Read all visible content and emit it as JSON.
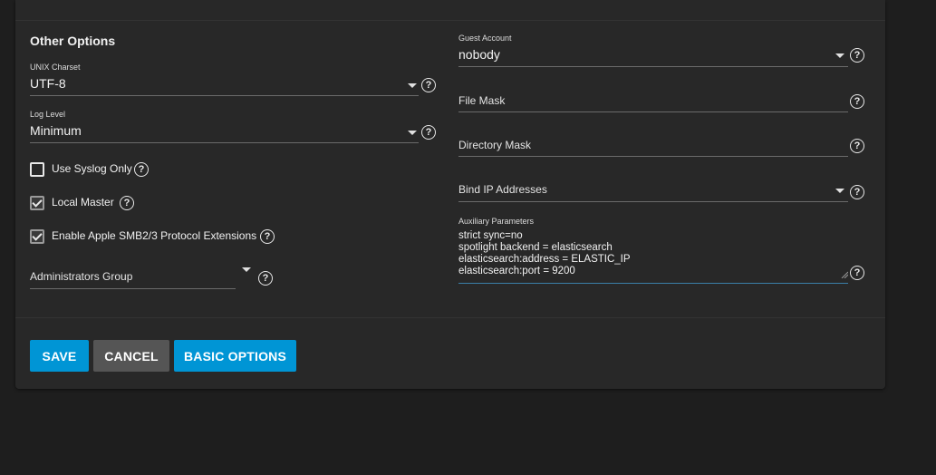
{
  "section": {
    "title": "Other Options"
  },
  "left": {
    "unix_charset": {
      "label": "UNIX Charset",
      "value": "UTF-8"
    },
    "log_level": {
      "label": "Log Level",
      "value": "Minimum"
    },
    "use_syslog": {
      "label": "Use Syslog Only",
      "checked": false
    },
    "local_master": {
      "label": "Local Master",
      "checked": true
    },
    "apple_ext": {
      "label": "Enable Apple SMB2/3 Protocol Extensions",
      "checked": true
    },
    "admin_group": {
      "placeholder": "Administrators Group"
    }
  },
  "right": {
    "guest_account": {
      "label": "Guest Account",
      "value": "nobody"
    },
    "file_mask": {
      "placeholder": "File Mask"
    },
    "directory_mask": {
      "placeholder": "Directory Mask"
    },
    "bind_ip": {
      "placeholder": "Bind IP Addresses"
    },
    "aux_params": {
      "label": "Auxiliary Parameters",
      "value": "strict sync=no\nspotlight backend = elasticsearch\nelasticsearch:address = ELASTIC_IP\nelasticsearch:port = 9200"
    }
  },
  "help_glyph": "?",
  "buttons": {
    "save": "SAVE",
    "cancel": "CANCEL",
    "basic_options": "BASIC OPTIONS"
  },
  "colors": {
    "background": "#1e1e1e",
    "card": "#282828",
    "primary": "#0095d5",
    "secondary": "#555555",
    "focus_underline": "#3b7fa8"
  },
  "icons": {
    "help": "help-circle-icon",
    "dropdown": "chevron-down-icon",
    "check": "check-icon"
  }
}
